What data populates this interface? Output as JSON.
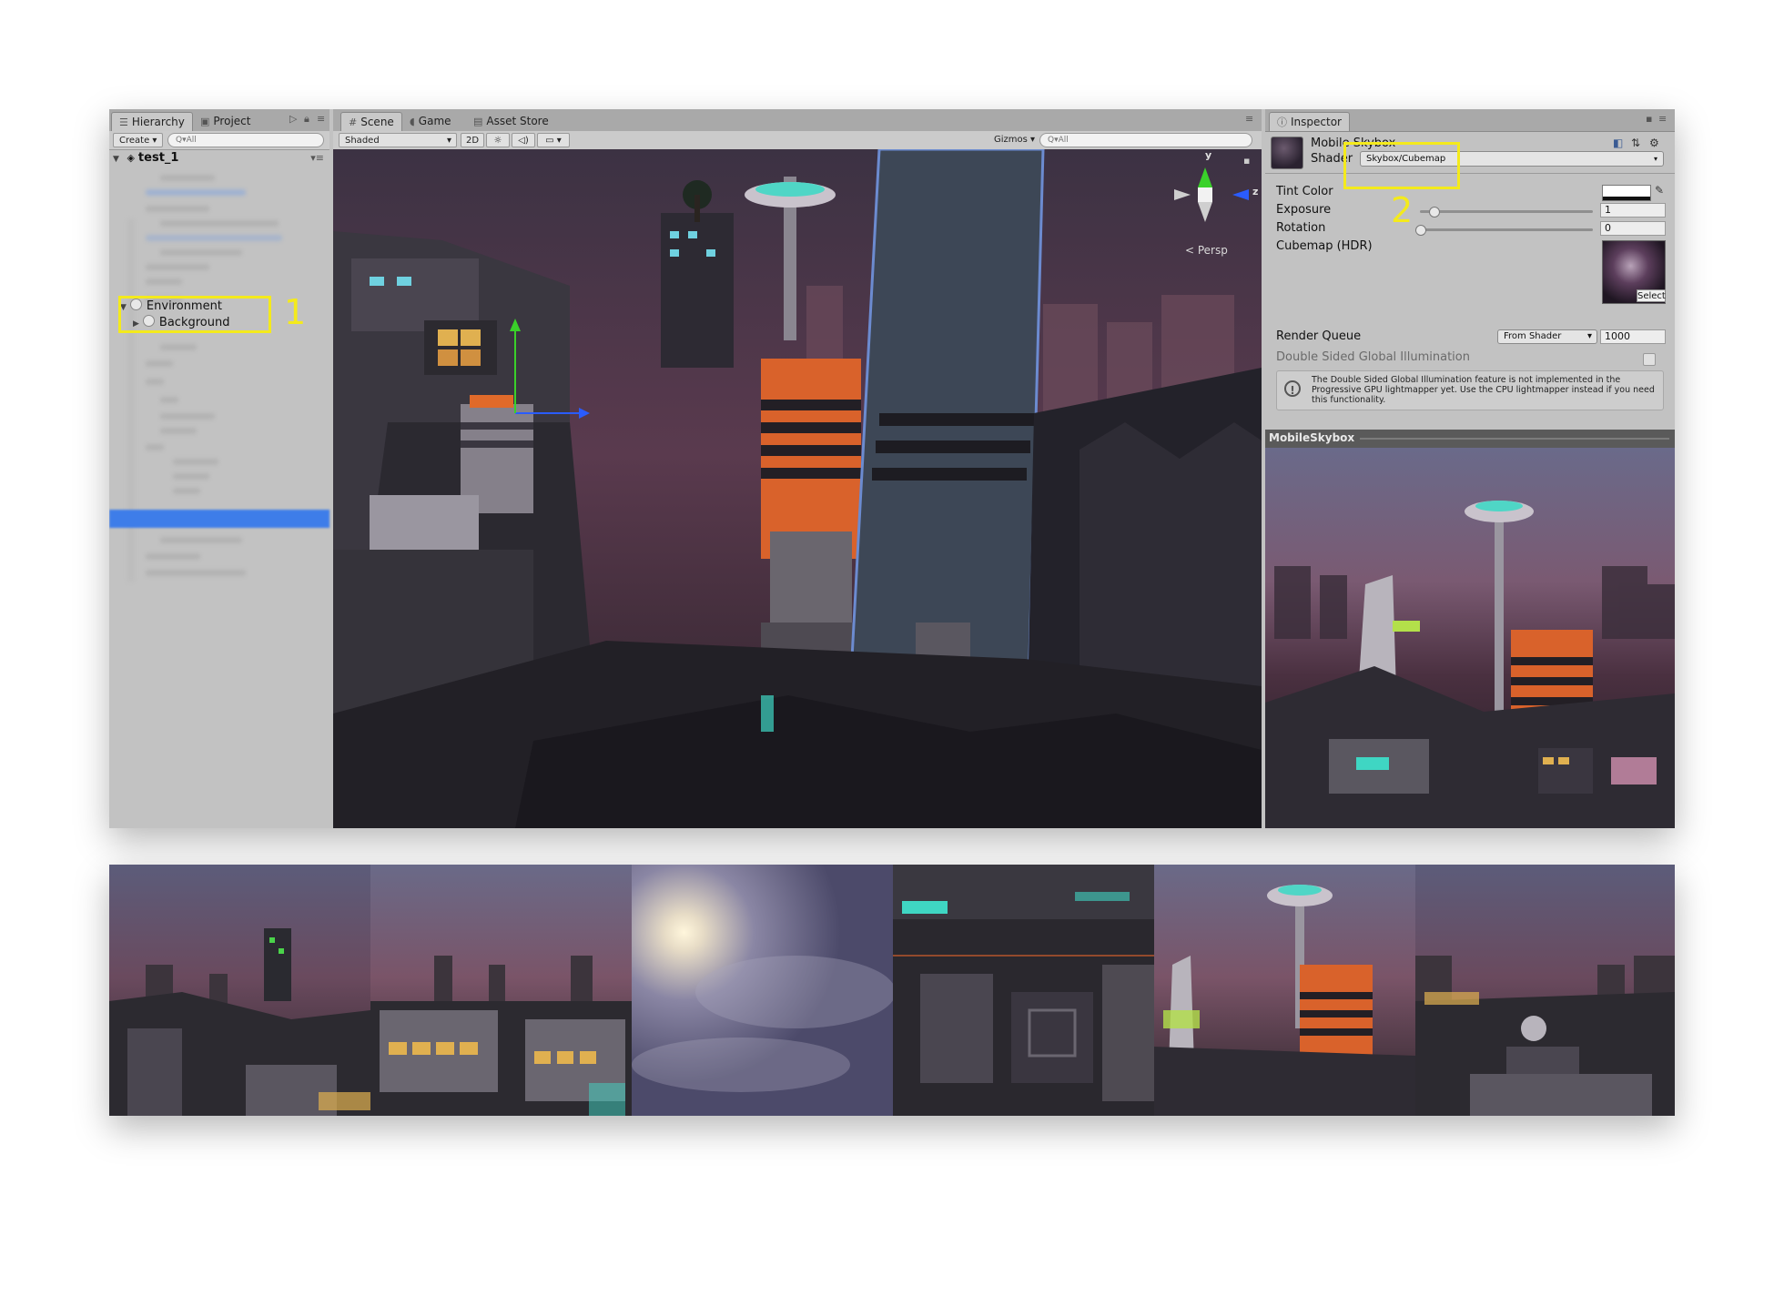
{
  "hierarchy": {
    "tabs": [
      {
        "label": "Hierarchy"
      },
      {
        "label": "Project"
      }
    ],
    "create_label": "Create",
    "search_placeholder": "Q▾All",
    "scene_name": "test_1",
    "items": [
      {
        "label": "Environment",
        "expanded": true
      },
      {
        "label": "Background",
        "expanded": false
      }
    ],
    "annotation_number": "1"
  },
  "scene_view": {
    "tabs": [
      {
        "label": "Scene"
      },
      {
        "label": "Game"
      },
      {
        "label": "Asset Store"
      }
    ],
    "shading_mode": "Shaded",
    "toggle_2d": "2D",
    "gizmos_label": "Gizmos",
    "search_placeholder": "Q▾All",
    "projection_label": "< Persp",
    "axis_labels": {
      "y": "y",
      "z": "z"
    }
  },
  "inspector": {
    "tab_label": "Inspector",
    "material_name": "Mobile Skybox",
    "shader_label": "Shader",
    "shader_value": "Skybox/Cubemap",
    "annotation_number": "2",
    "properties": {
      "tint_color": {
        "label": "Tint Color"
      },
      "exposure": {
        "label": "Exposure",
        "value": "1",
        "slider_fraction": 0.08
      },
      "rotation": {
        "label": "Rotation",
        "value": "0",
        "slider_fraction": 0.0
      },
      "cubemap": {
        "label": "Cubemap   (HDR)",
        "select_label": "Select"
      }
    },
    "render_queue": {
      "label": "Render Queue",
      "mode": "From Shader",
      "value": "1000"
    },
    "double_sided_gi": {
      "label": "Double Sided Global Illumination"
    },
    "help_text": "The Double Sided Global Illumination feature is not implemented in the Progressive GPU lightmapper yet. Use the CPU lightmapper instead if you need this functionality.",
    "preview_title": "MobileSkybox"
  },
  "colors": {
    "highlight": "#f4ea1c",
    "selection": "#3e7de9",
    "sky_purple": "#4a3546",
    "accent_orange": "#d9622b",
    "accent_teal": "#3fd6c3"
  }
}
